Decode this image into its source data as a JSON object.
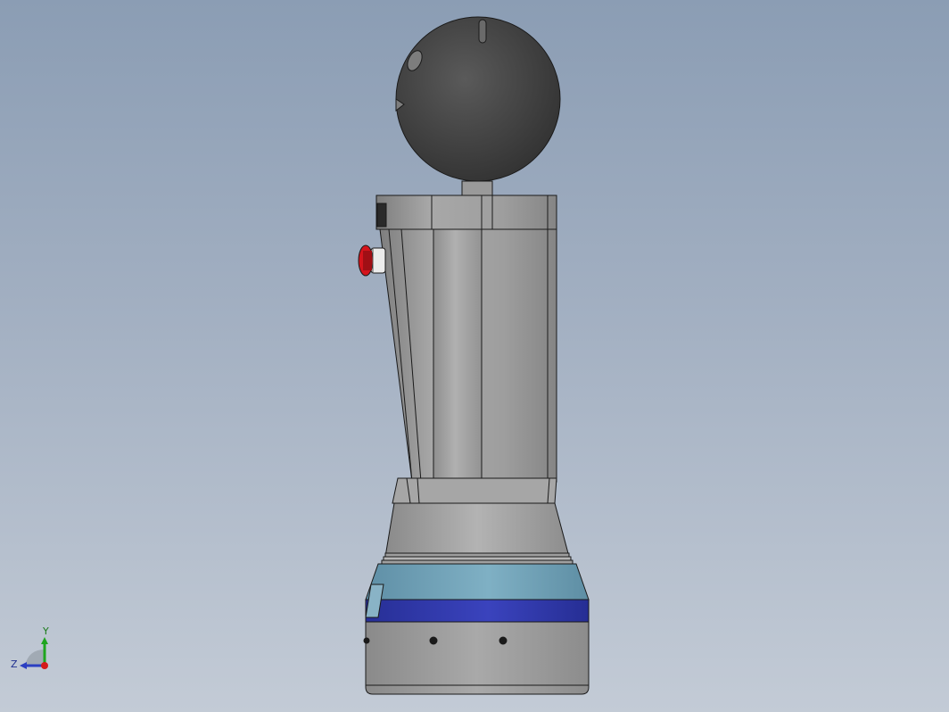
{
  "scene": {
    "background_top": "#8b9db4",
    "background_bottom": "#c3cbd6",
    "colors": {
      "head": "#454545",
      "body_gray": "#9a9a9a",
      "base_teal": "#6fa3b8",
      "base_blue": "#2e36a8",
      "emergency_stop": "#d4141c"
    }
  },
  "triad": {
    "y_label": "Y",
    "z_label": "Z",
    "y_color": "#1fa51f",
    "z_color": "#2b3fc2",
    "x_color": "#d41a1a"
  }
}
